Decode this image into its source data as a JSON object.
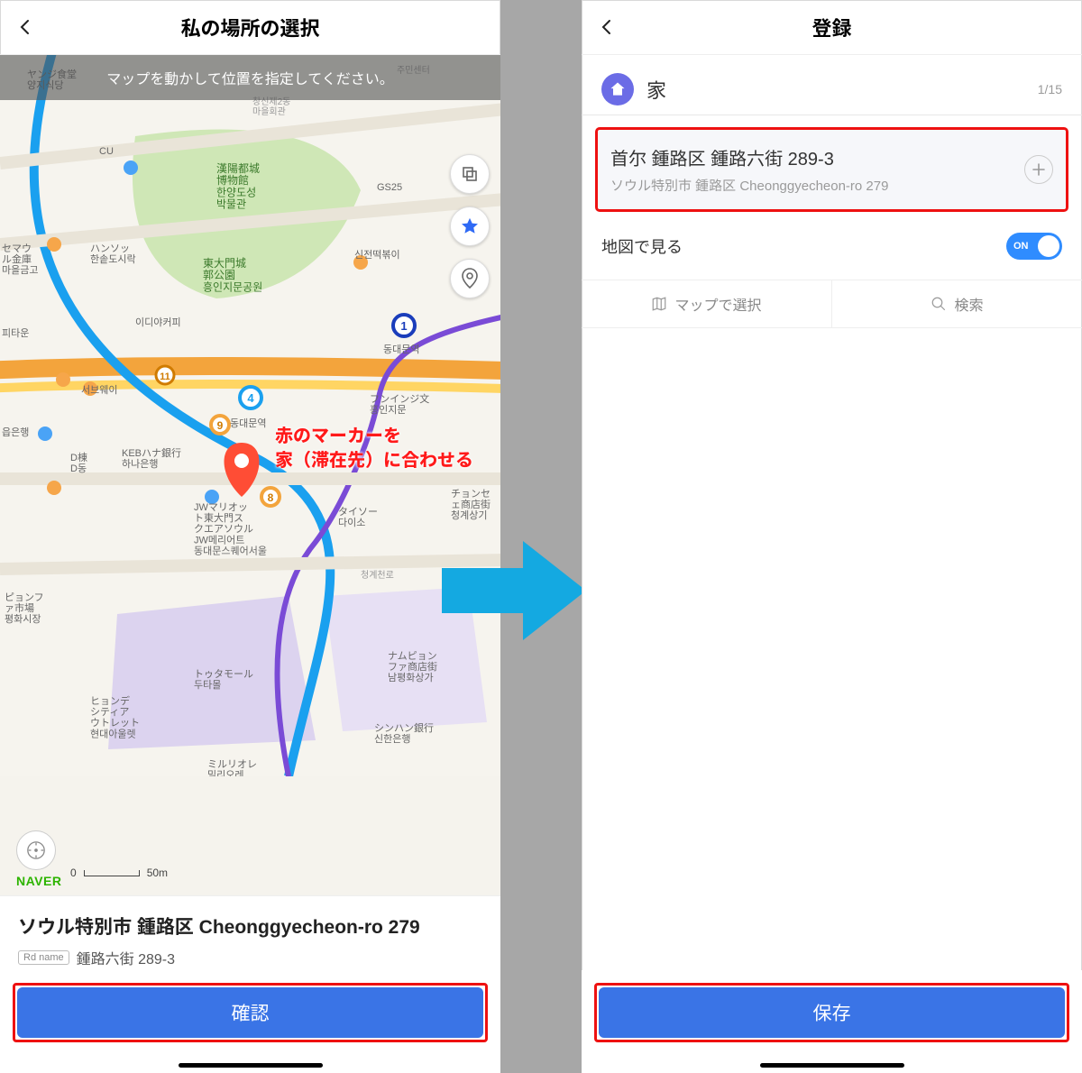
{
  "left": {
    "title": "私の場所の選択",
    "banner": "マップを動かして位置を指定してください。",
    "annotation_line1": "赤のマーカーを",
    "annotation_line2": "家（滞在先）に合わせる",
    "scale_zero": "0",
    "scale_dist": "50m",
    "brand": "NAVER",
    "addr_main": "ソウル特別市 鍾路区 Cheonggyecheon-ro 279",
    "rd_badge": "Rd name",
    "addr_sub": "鍾路六街 289-3",
    "confirm": "確認",
    "map_labels": {
      "a": "ヤンジ食堂\n양지식당",
      "b": "주민센터",
      "c": "창신제2동\n마을회관",
      "d": "漢陽都城\n博物館\n한양도성\n박물관",
      "e": "GS25",
      "f": "東大門城\n郭公園\n흥인지문공원",
      "g": "신전떡볶이",
      "h": "ハンソッ\n한솥도시락",
      "i": "이디야커피",
      "j": "동대문역",
      "k": "フンインジ文\n흥인지문",
      "l": "서브웨이",
      "m": "동대문역",
      "n": "D棟\nD동",
      "o": "KEBハナ銀行\n하나은행",
      "p": "JWマリオッ\nト東大門ス\nクエアソウル\nJW메리어트\n동대문스퀘어서울",
      "q": "タイソー\n다이소",
      "r": "청계천로",
      "s": "ナムピョン\nファ商店街\n남평화상가",
      "t": "トゥタモール\n두타몰",
      "u": "ヒョンデ\nシティア\nウトレット\n현대아울렛",
      "v": "シンハン銀行\n신한은행",
      "w": "ミルリオレ\n밀리오레",
      "x": "チョンセ\nェ商店街\n청계상기",
      "y": "セマウ\nル金庫\n마을금고",
      "z": "읍은행",
      "aa": "ピョンフ\nァ市場\n평화시장",
      "bb": "피타운",
      "cc": "CU"
    }
  },
  "right": {
    "title": "登録",
    "name": "家",
    "counter": "1/15",
    "addr1": "首尔 鍾路区 鍾路六街 289-3",
    "addr2": "ソウル特別市 鍾路区 Cheonggyecheon-ro 279",
    "toggle_label": "地図で見る",
    "toggle_state": "ON",
    "tab_map": "マップで選択",
    "tab_search": "検索",
    "save": "保存"
  }
}
